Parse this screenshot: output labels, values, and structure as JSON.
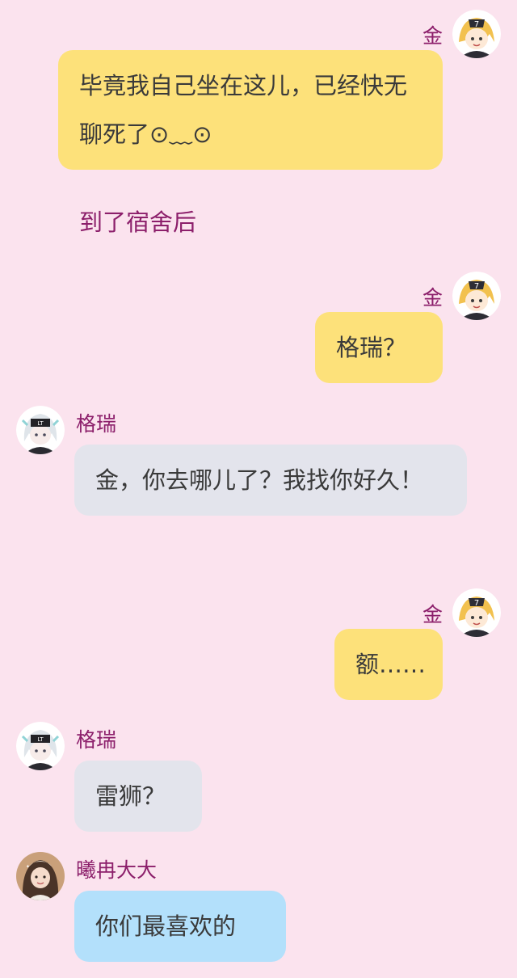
{
  "messages": [
    {
      "sender": "金",
      "side": "right",
      "text": "毕竟我自己坐在这儿，已经快无聊死了⊙﹏⊙"
    },
    {
      "narration": "到了宿舍后"
    },
    {
      "sender": "金",
      "side": "right",
      "text": "格瑞？"
    },
    {
      "sender": "格瑞",
      "side": "left",
      "text": "金，你去哪儿了？我找你好久！"
    },
    {
      "sender": "金",
      "side": "right",
      "text": "额……"
    },
    {
      "sender": "格瑞",
      "side": "left",
      "text": "雷狮？"
    },
    {
      "sender": "曦冉大大",
      "side": "left",
      "text": "你们最喜欢的"
    }
  ],
  "colors": {
    "background": "#fbe3ee",
    "name": "#8c1f6b",
    "bubble_jin": "#fde17a",
    "bubble_grey": "#e3e4ec",
    "bubble_blue": "#b3e0fb"
  },
  "icons": {
    "jin_avatar": "blonde-boy-avatar-icon",
    "grey_avatar": "silver-haired-boy-avatar-icon",
    "xiran_avatar": "girl-photo-avatar-icon"
  }
}
